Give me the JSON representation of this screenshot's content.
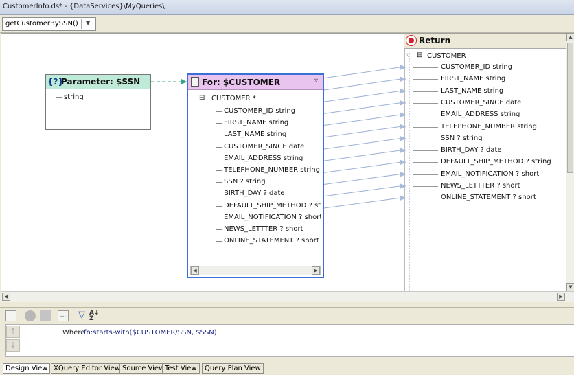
{
  "window": {
    "title": "CustomerInfo.ds* - {DataServices}\\MyQueries\\"
  },
  "toolbar": {
    "function_select": "getCustomerBySSN()"
  },
  "param_node": {
    "title": "Parameter: $SSN",
    "icon_text": "{?}",
    "type": "string"
  },
  "for_node": {
    "title": "For: $CUSTOMER",
    "root": "CUSTOMER *",
    "fields": [
      "CUSTOMER_ID string",
      "FIRST_NAME string",
      "LAST_NAME string",
      "CUSTOMER_SINCE date",
      "EMAIL_ADDRESS string",
      "TELEPHONE_NUMBER string",
      "SSN ? string",
      "BIRTH_DAY ? date",
      "DEFAULT_SHIP_METHOD ? strir",
      "EMAIL_NOTIFICATION ? short",
      "NEWS_LETTTER ? short",
      "ONLINE_STATEMENT ? short"
    ]
  },
  "return_node": {
    "title": "Return",
    "root": "CUSTOMER",
    "fields": [
      "CUSTOMER_ID string",
      "FIRST_NAME string",
      "LAST_NAME string",
      "CUSTOMER_SINCE date",
      "EMAIL_ADDRESS string",
      "TELEPHONE_NUMBER string",
      "SSN ? string",
      "BIRTH_DAY ? date",
      "DEFAULT_SHIP_METHOD ? string",
      "EMAIL_NOTIFICATION ? short",
      "NEWS_LETTTER ? short",
      "ONLINE_STATEMENT ? short"
    ]
  },
  "where": {
    "label": "Where",
    "expression": "fn:starts-with($CUSTOMER/SSN, $SSN)"
  },
  "tabs": [
    "Design View",
    "XQuery Editor View",
    "Source View",
    "Test View",
    "Query Plan View"
  ],
  "active_tab": "Design View",
  "colors": {
    "param_header": "#bfead8",
    "for_header": "#e8c4ee",
    "for_border": "#3a6fd8",
    "link_line": "#9bb0d4",
    "return_icon": "#d0202a"
  }
}
